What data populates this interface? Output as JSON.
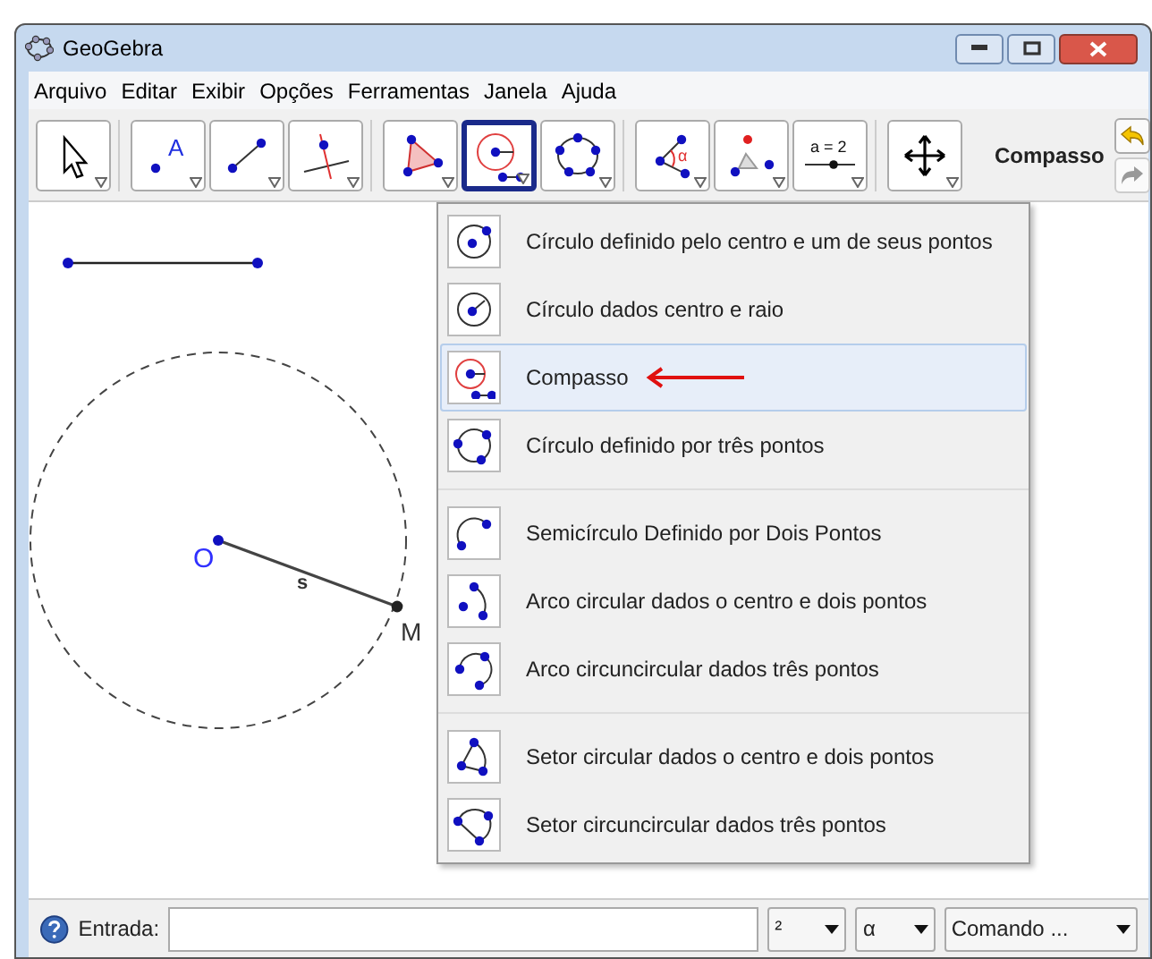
{
  "window": {
    "title": "GeoGebra"
  },
  "menu_bar": [
    "Arquivo",
    "Editar",
    "Exibir",
    "Opções",
    "Ferramentas",
    "Janela",
    "Ajuda"
  ],
  "toolbar": {
    "groups": [
      [
        {
          "kind": "move",
          "selected": false
        }
      ],
      [
        {
          "kind": "point",
          "selected": false,
          "icon_text": "A"
        },
        {
          "kind": "segment",
          "selected": false
        },
        {
          "kind": "perpendicular",
          "selected": false
        }
      ],
      [
        {
          "kind": "polygon",
          "selected": false
        },
        {
          "kind": "compass",
          "selected": true
        },
        {
          "kind": "conic",
          "selected": false
        }
      ],
      [
        {
          "kind": "angle",
          "selected": false,
          "icon_text": "α"
        },
        {
          "kind": "reflect",
          "selected": false
        },
        {
          "kind": "slider",
          "selected": false,
          "icon_text": "a = 2"
        }
      ],
      [
        {
          "kind": "pan",
          "selected": false
        }
      ]
    ],
    "tool_name": "Compasso"
  },
  "canvas": {
    "center_label": "O",
    "segment_label": "s",
    "point_label": "M"
  },
  "tool_menu": {
    "groups": [
      [
        {
          "kind": "circle-point",
          "label": "Círculo definido pelo centro e um de seus pontos",
          "selected": false,
          "pointer_arrow": false
        },
        {
          "kind": "circle-radius",
          "label": "Círculo dados centro e raio",
          "selected": false,
          "pointer_arrow": false
        },
        {
          "kind": "compass",
          "label": "Compasso",
          "selected": true,
          "pointer_arrow": true
        },
        {
          "kind": "circle-three",
          "label": "Círculo definido por três pontos",
          "selected": false,
          "pointer_arrow": false
        }
      ],
      [
        {
          "kind": "semicircle",
          "label": "Semicírculo Definido por Dois Pontos",
          "selected": false,
          "pointer_arrow": false
        },
        {
          "kind": "arc-center",
          "label": "Arco circular dados o centro e dois pontos",
          "selected": false,
          "pointer_arrow": false
        },
        {
          "kind": "arc-three",
          "label": "Arco circuncircular dados três pontos",
          "selected": false,
          "pointer_arrow": false
        }
      ],
      [
        {
          "kind": "sector-center",
          "label": "Setor circular dados o centro e dois pontos",
          "selected": false,
          "pointer_arrow": false
        },
        {
          "kind": "sector-three",
          "label": "Setor circuncircular dados três pontos",
          "selected": false,
          "pointer_arrow": false
        }
      ]
    ]
  },
  "input_bar": {
    "label": "Entrada:",
    "dropdowns": [
      "²",
      "α",
      "Comando ..."
    ]
  }
}
